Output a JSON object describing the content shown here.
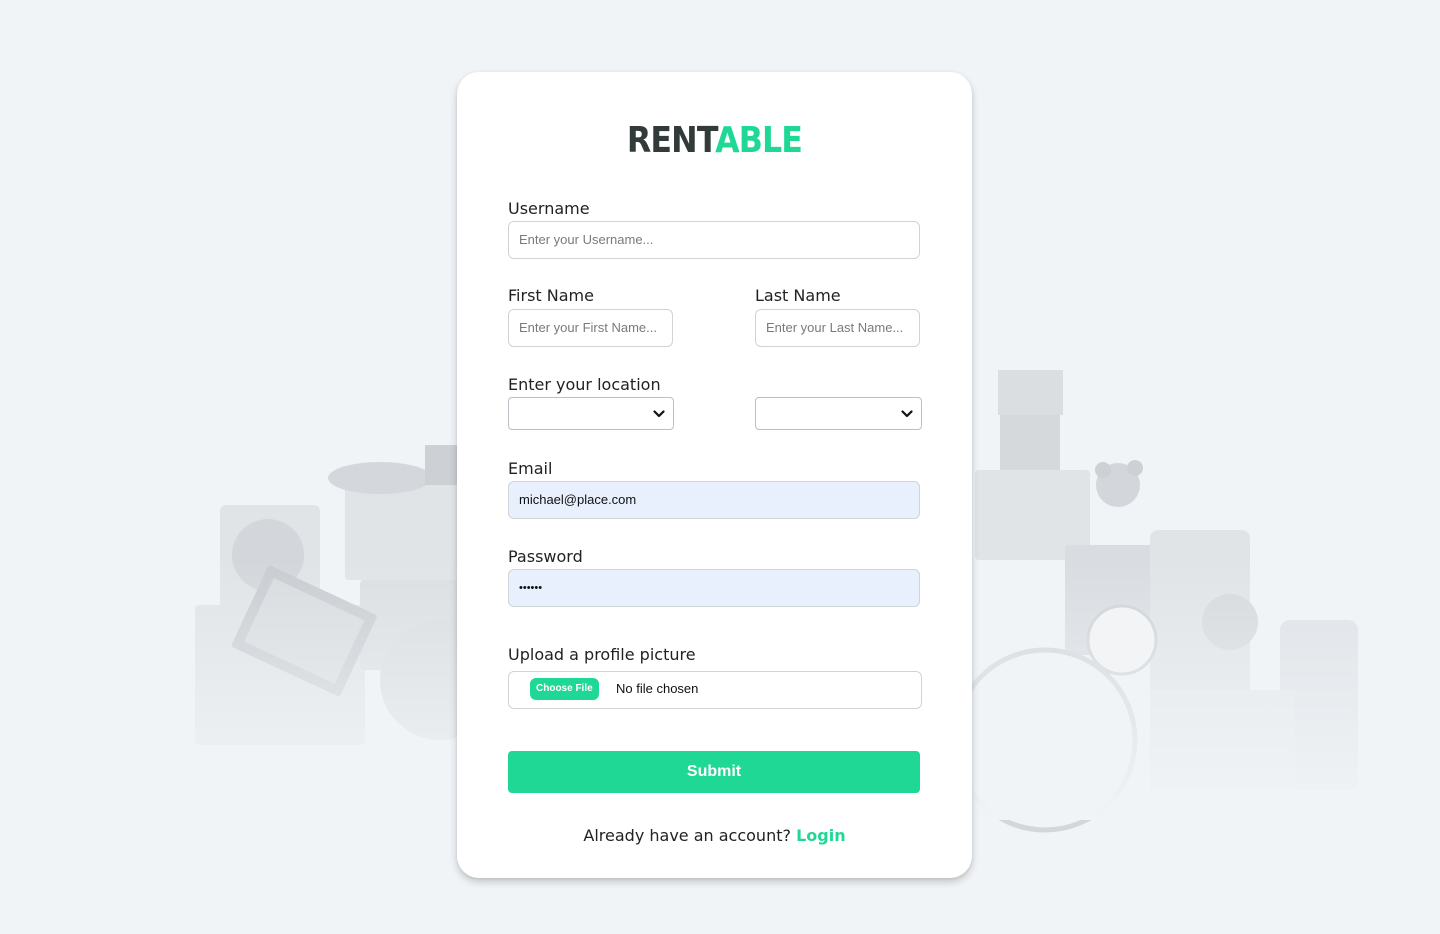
{
  "brand": {
    "part1": "RENT",
    "part2": "ABLE",
    "accent": "#1fd895",
    "dark": "#333b3a"
  },
  "form": {
    "username": {
      "label": "Username",
      "placeholder": "Enter your Username...",
      "value": ""
    },
    "first_name": {
      "label": "First Name",
      "placeholder": "Enter your First Name...",
      "value": ""
    },
    "last_name": {
      "label": "Last Name",
      "placeholder": "Enter your Last Name...",
      "value": ""
    },
    "location": {
      "label": "Enter your location",
      "select1_value": "",
      "select2_value": ""
    },
    "email": {
      "label": "Email",
      "value": "michael@place.com"
    },
    "password": {
      "label": "Password",
      "value": "••••••"
    },
    "upload": {
      "label": "Upload a profile picture",
      "button_label": "Choose File",
      "status": "No file chosen"
    },
    "submit_label": "Submit"
  },
  "footer": {
    "text": "Already have an account?",
    "link": "Login"
  }
}
